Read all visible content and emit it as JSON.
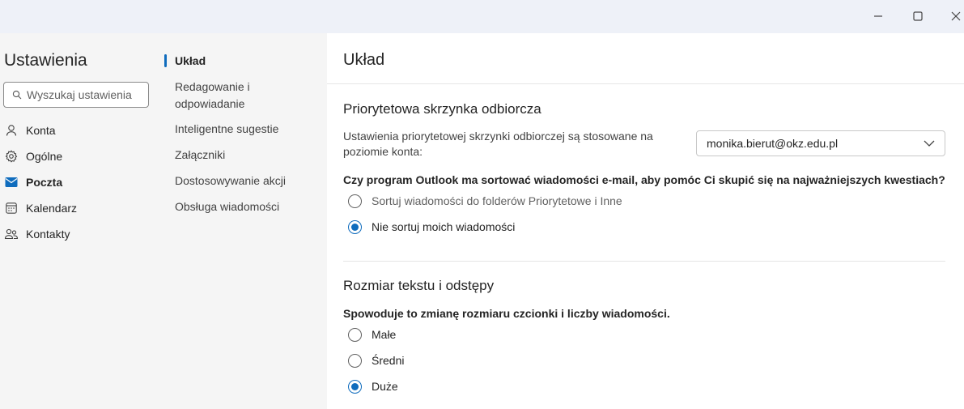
{
  "window": {
    "controls": [
      "minimize-icon",
      "maximize-icon",
      "close-icon"
    ]
  },
  "nav": {
    "title": "Ustawienia",
    "search_placeholder": "Wyszukaj ustawienia",
    "items": [
      {
        "label": "Konta",
        "icon": "person-icon"
      },
      {
        "label": "Ogólne",
        "icon": "gear-icon"
      },
      {
        "label": "Poczta",
        "icon": "mail-icon",
        "active": true
      },
      {
        "label": "Kalendarz",
        "icon": "calendar-icon"
      },
      {
        "label": "Kontakty",
        "icon": "people-icon"
      }
    ]
  },
  "subnav": {
    "items": [
      {
        "label": "Układ",
        "active": true
      },
      {
        "label": "Redagowanie i odpowiadanie"
      },
      {
        "label": "Inteligentne sugestie"
      },
      {
        "label": "Załączniki"
      },
      {
        "label": "Dostosowywanie akcji"
      },
      {
        "label": "Obsługa wiadomości"
      }
    ]
  },
  "main": {
    "title": "Układ",
    "focused_inbox": {
      "title": "Priorytetowa skrzynka odbiorcza",
      "description": "Ustawienia priorytetowej skrzynki odbiorczej są stosowane na poziomie konta:",
      "account": "monika.bierut@okz.edu.pl",
      "question": "Czy program Outlook ma sortować wiadomości e-mail, aby pomóc Ci skupić się na najważniejszych kwestiach?",
      "options": [
        {
          "label": "Sortuj wiadomości do folderów Priorytetowe i Inne",
          "checked": false
        },
        {
          "label": "Nie sortuj moich wiadomości",
          "checked": true
        }
      ]
    },
    "text_size": {
      "title": "Rozmiar tekstu i odstępy",
      "question": "Spowoduje to zmianę rozmiaru czcionki i liczby wiadomości.",
      "options": [
        {
          "label": "Małe",
          "checked": false
        },
        {
          "label": "Średni",
          "checked": false
        },
        {
          "label": "Duże",
          "checked": true
        }
      ]
    }
  },
  "colors": {
    "accent": "#0f6cbd",
    "titlebar": "#eef1f8",
    "sidebar": "#f5f5f5"
  }
}
